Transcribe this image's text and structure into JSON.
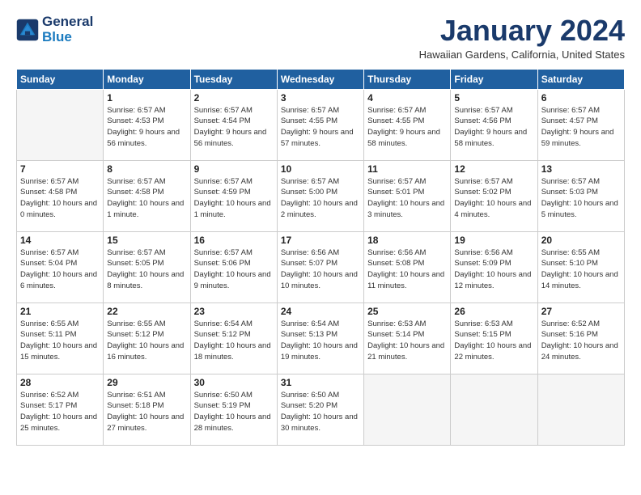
{
  "logo": {
    "line1": "General",
    "line2": "Blue"
  },
  "title": "January 2024",
  "location": "Hawaiian Gardens, California, United States",
  "weekdays": [
    "Sunday",
    "Monday",
    "Tuesday",
    "Wednesday",
    "Thursday",
    "Friday",
    "Saturday"
  ],
  "weeks": [
    [
      {
        "day": "",
        "sunrise": "",
        "sunset": "",
        "daylight": ""
      },
      {
        "day": "1",
        "sunrise": "Sunrise: 6:57 AM",
        "sunset": "Sunset: 4:53 PM",
        "daylight": "Daylight: 9 hours and 56 minutes."
      },
      {
        "day": "2",
        "sunrise": "Sunrise: 6:57 AM",
        "sunset": "Sunset: 4:54 PM",
        "daylight": "Daylight: 9 hours and 56 minutes."
      },
      {
        "day": "3",
        "sunrise": "Sunrise: 6:57 AM",
        "sunset": "Sunset: 4:55 PM",
        "daylight": "Daylight: 9 hours and 57 minutes."
      },
      {
        "day": "4",
        "sunrise": "Sunrise: 6:57 AM",
        "sunset": "Sunset: 4:55 PM",
        "daylight": "Daylight: 9 hours and 58 minutes."
      },
      {
        "day": "5",
        "sunrise": "Sunrise: 6:57 AM",
        "sunset": "Sunset: 4:56 PM",
        "daylight": "Daylight: 9 hours and 58 minutes."
      },
      {
        "day": "6",
        "sunrise": "Sunrise: 6:57 AM",
        "sunset": "Sunset: 4:57 PM",
        "daylight": "Daylight: 9 hours and 59 minutes."
      }
    ],
    [
      {
        "day": "7",
        "sunrise": "Sunrise: 6:57 AM",
        "sunset": "Sunset: 4:58 PM",
        "daylight": "Daylight: 10 hours and 0 minutes."
      },
      {
        "day": "8",
        "sunrise": "Sunrise: 6:57 AM",
        "sunset": "Sunset: 4:58 PM",
        "daylight": "Daylight: 10 hours and 1 minute."
      },
      {
        "day": "9",
        "sunrise": "Sunrise: 6:57 AM",
        "sunset": "Sunset: 4:59 PM",
        "daylight": "Daylight: 10 hours and 1 minute."
      },
      {
        "day": "10",
        "sunrise": "Sunrise: 6:57 AM",
        "sunset": "Sunset: 5:00 PM",
        "daylight": "Daylight: 10 hours and 2 minutes."
      },
      {
        "day": "11",
        "sunrise": "Sunrise: 6:57 AM",
        "sunset": "Sunset: 5:01 PM",
        "daylight": "Daylight: 10 hours and 3 minutes."
      },
      {
        "day": "12",
        "sunrise": "Sunrise: 6:57 AM",
        "sunset": "Sunset: 5:02 PM",
        "daylight": "Daylight: 10 hours and 4 minutes."
      },
      {
        "day": "13",
        "sunrise": "Sunrise: 6:57 AM",
        "sunset": "Sunset: 5:03 PM",
        "daylight": "Daylight: 10 hours and 5 minutes."
      }
    ],
    [
      {
        "day": "14",
        "sunrise": "Sunrise: 6:57 AM",
        "sunset": "Sunset: 5:04 PM",
        "daylight": "Daylight: 10 hours and 6 minutes."
      },
      {
        "day": "15",
        "sunrise": "Sunrise: 6:57 AM",
        "sunset": "Sunset: 5:05 PM",
        "daylight": "Daylight: 10 hours and 8 minutes."
      },
      {
        "day": "16",
        "sunrise": "Sunrise: 6:57 AM",
        "sunset": "Sunset: 5:06 PM",
        "daylight": "Daylight: 10 hours and 9 minutes."
      },
      {
        "day": "17",
        "sunrise": "Sunrise: 6:56 AM",
        "sunset": "Sunset: 5:07 PM",
        "daylight": "Daylight: 10 hours and 10 minutes."
      },
      {
        "day": "18",
        "sunrise": "Sunrise: 6:56 AM",
        "sunset": "Sunset: 5:08 PM",
        "daylight": "Daylight: 10 hours and 11 minutes."
      },
      {
        "day": "19",
        "sunrise": "Sunrise: 6:56 AM",
        "sunset": "Sunset: 5:09 PM",
        "daylight": "Daylight: 10 hours and 12 minutes."
      },
      {
        "day": "20",
        "sunrise": "Sunrise: 6:55 AM",
        "sunset": "Sunset: 5:10 PM",
        "daylight": "Daylight: 10 hours and 14 minutes."
      }
    ],
    [
      {
        "day": "21",
        "sunrise": "Sunrise: 6:55 AM",
        "sunset": "Sunset: 5:11 PM",
        "daylight": "Daylight: 10 hours and 15 minutes."
      },
      {
        "day": "22",
        "sunrise": "Sunrise: 6:55 AM",
        "sunset": "Sunset: 5:12 PM",
        "daylight": "Daylight: 10 hours and 16 minutes."
      },
      {
        "day": "23",
        "sunrise": "Sunrise: 6:54 AM",
        "sunset": "Sunset: 5:12 PM",
        "daylight": "Daylight: 10 hours and 18 minutes."
      },
      {
        "day": "24",
        "sunrise": "Sunrise: 6:54 AM",
        "sunset": "Sunset: 5:13 PM",
        "daylight": "Daylight: 10 hours and 19 minutes."
      },
      {
        "day": "25",
        "sunrise": "Sunrise: 6:53 AM",
        "sunset": "Sunset: 5:14 PM",
        "daylight": "Daylight: 10 hours and 21 minutes."
      },
      {
        "day": "26",
        "sunrise": "Sunrise: 6:53 AM",
        "sunset": "Sunset: 5:15 PM",
        "daylight": "Daylight: 10 hours and 22 minutes."
      },
      {
        "day": "27",
        "sunrise": "Sunrise: 6:52 AM",
        "sunset": "Sunset: 5:16 PM",
        "daylight": "Daylight: 10 hours and 24 minutes."
      }
    ],
    [
      {
        "day": "28",
        "sunrise": "Sunrise: 6:52 AM",
        "sunset": "Sunset: 5:17 PM",
        "daylight": "Daylight: 10 hours and 25 minutes."
      },
      {
        "day": "29",
        "sunrise": "Sunrise: 6:51 AM",
        "sunset": "Sunset: 5:18 PM",
        "daylight": "Daylight: 10 hours and 27 minutes."
      },
      {
        "day": "30",
        "sunrise": "Sunrise: 6:50 AM",
        "sunset": "Sunset: 5:19 PM",
        "daylight": "Daylight: 10 hours and 28 minutes."
      },
      {
        "day": "31",
        "sunrise": "Sunrise: 6:50 AM",
        "sunset": "Sunset: 5:20 PM",
        "daylight": "Daylight: 10 hours and 30 minutes."
      },
      {
        "day": "",
        "sunrise": "",
        "sunset": "",
        "daylight": ""
      },
      {
        "day": "",
        "sunrise": "",
        "sunset": "",
        "daylight": ""
      },
      {
        "day": "",
        "sunrise": "",
        "sunset": "",
        "daylight": ""
      }
    ]
  ]
}
